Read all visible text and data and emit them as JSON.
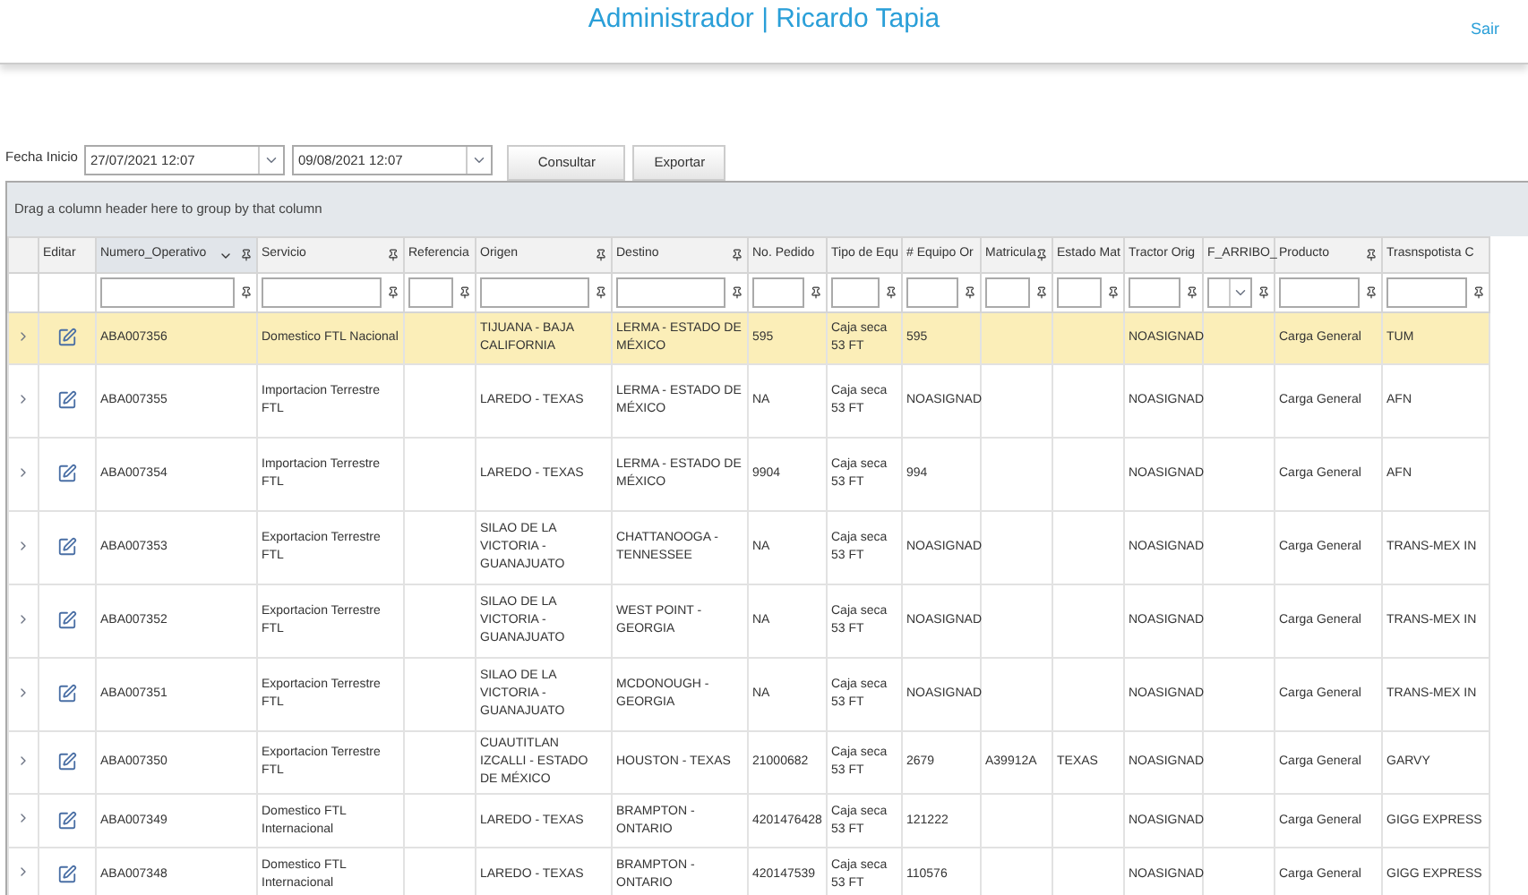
{
  "header": {
    "title": "Administrador | Ricardo Tapia",
    "logout": "Sair"
  },
  "filters": {
    "label": "Fecha Inicio",
    "start": "27/07/2021 12:07",
    "end": "09/08/2021 12:07",
    "buttons": [
      "Consultar",
      "Exportar"
    ]
  },
  "grid": {
    "group_hint": "Drag a column header here to group by that column",
    "edit_header": "Editar",
    "columns": [
      {
        "label": "Numero_Operativo",
        "dropdown_filter": false,
        "pin": true,
        "sort": true
      },
      {
        "label": "Servicio",
        "dropdown_filter": false,
        "pin": true,
        "sort": false
      },
      {
        "label": "Referencia",
        "dropdown_filter": false,
        "pin": false,
        "sort": false
      },
      {
        "label": "Origen",
        "dropdown_filter": false,
        "pin": true,
        "sort": false
      },
      {
        "label": "Destino",
        "dropdown_filter": false,
        "pin": true,
        "sort": false
      },
      {
        "label": "No. Pedido",
        "dropdown_filter": false,
        "pin": false,
        "sort": false
      },
      {
        "label": "Tipo de Equ",
        "dropdown_filter": false,
        "pin": false,
        "sort": false
      },
      {
        "label": "# Equipo Or",
        "dropdown_filter": false,
        "pin": false,
        "sort": false
      },
      {
        "label": "Matricula",
        "dropdown_filter": false,
        "pin": true,
        "sort": false
      },
      {
        "label": "Estado Mat",
        "dropdown_filter": false,
        "pin": false,
        "sort": false
      },
      {
        "label": "Tractor Orig",
        "dropdown_filter": false,
        "pin": false,
        "sort": false
      },
      {
        "label": "F_ARRIBO_",
        "dropdown_filter": true,
        "pin": false,
        "sort": false
      },
      {
        "label": "Producto",
        "dropdown_filter": false,
        "pin": true,
        "sort": false
      },
      {
        "label": "Trasnspotista C",
        "dropdown_filter": false,
        "pin": false,
        "sort": false
      }
    ],
    "rows": [
      {
        "selected": true,
        "cells": [
          "ABA007356",
          "Domestico FTL Nacional",
          "",
          "TIJUANA - BAJA CALIFORNIA",
          "LERMA - ESTADO DE MÉXICO",
          "595",
          "Caja seca 53 FT",
          "595",
          "",
          "",
          "NOASIGNAD",
          "",
          "Carga General",
          "TUM"
        ]
      },
      {
        "selected": false,
        "cells": [
          "ABA007355",
          "Importacion Terrestre FTL",
          "",
          "LAREDO - TEXAS",
          "LERMA - ESTADO DE MÉXICO",
          "NA",
          "Caja seca 53 FT",
          "NOASIGNAD",
          "",
          "",
          "NOASIGNAD",
          "",
          "Carga General",
          "AFN"
        ]
      },
      {
        "selected": false,
        "cells": [
          "ABA007354",
          "Importacion Terrestre FTL",
          "",
          "LAREDO - TEXAS",
          "LERMA - ESTADO DE MÉXICO",
          "9904",
          "Caja seca 53 FT",
          "994",
          "",
          "",
          "NOASIGNAD",
          "",
          "Carga General",
          "AFN"
        ]
      },
      {
        "selected": false,
        "cells": [
          "ABA007353",
          "Exportacion Terrestre FTL",
          "",
          "SILAO DE LA VICTORIA - GUANAJUATO",
          "CHATTANOOGA - TENNESSEE",
          "NA",
          "Caja seca 53 FT",
          "NOASIGNAD",
          "",
          "",
          "NOASIGNAD",
          "",
          "Carga General",
          "TRANS-MEX IN"
        ]
      },
      {
        "selected": false,
        "cells": [
          "ABA007352",
          "Exportacion Terrestre FTL",
          "",
          "SILAO DE LA VICTORIA - GUANAJUATO",
          "WEST POINT - GEORGIA",
          "NA",
          "Caja seca 53 FT",
          "NOASIGNAD",
          "",
          "",
          "NOASIGNAD",
          "",
          "Carga General",
          "TRANS-MEX IN"
        ]
      },
      {
        "selected": false,
        "cells": [
          "ABA007351",
          "Exportacion Terrestre FTL",
          "",
          "SILAO DE LA VICTORIA - GUANAJUATO",
          "MCDONOUGH - GEORGIA",
          "NA",
          "Caja seca 53 FT",
          "NOASIGNAD",
          "",
          "",
          "NOASIGNAD",
          "",
          "Carga General",
          "TRANS-MEX IN"
        ]
      },
      {
        "selected": false,
        "cells": [
          "ABA007350",
          "Exportacion Terrestre FTL",
          "",
          "CUAUTITLAN IZCALLI - ESTADO DE MÉXICO",
          "HOUSTON - TEXAS",
          "21000682",
          "Caja seca 53 FT",
          "2679",
          "A39912A",
          "TEXAS",
          "NOASIGNAD",
          "",
          "Carga General",
          "GARVY"
        ]
      },
      {
        "selected": false,
        "cells": [
          "ABA007349",
          "Domestico FTL Internacional",
          "",
          "LAREDO - TEXAS",
          "BRAMPTON - ONTARIO",
          "4201476428",
          "Caja seca 53 FT",
          "121222",
          "",
          "",
          "NOASIGNAD",
          "",
          "Carga General",
          "GIGG EXPRESS"
        ]
      },
      {
        "selected": false,
        "cells": [
          "ABA007348",
          "Domestico FTL Internacional",
          "",
          "LAREDO - TEXAS",
          "BRAMPTON - ONTARIO",
          "420147539",
          "Caja seca 53 FT",
          "110576",
          "",
          "",
          "NOASIGNAD",
          "",
          "Carga General",
          "GIGG EXPRESS"
        ]
      }
    ]
  }
}
